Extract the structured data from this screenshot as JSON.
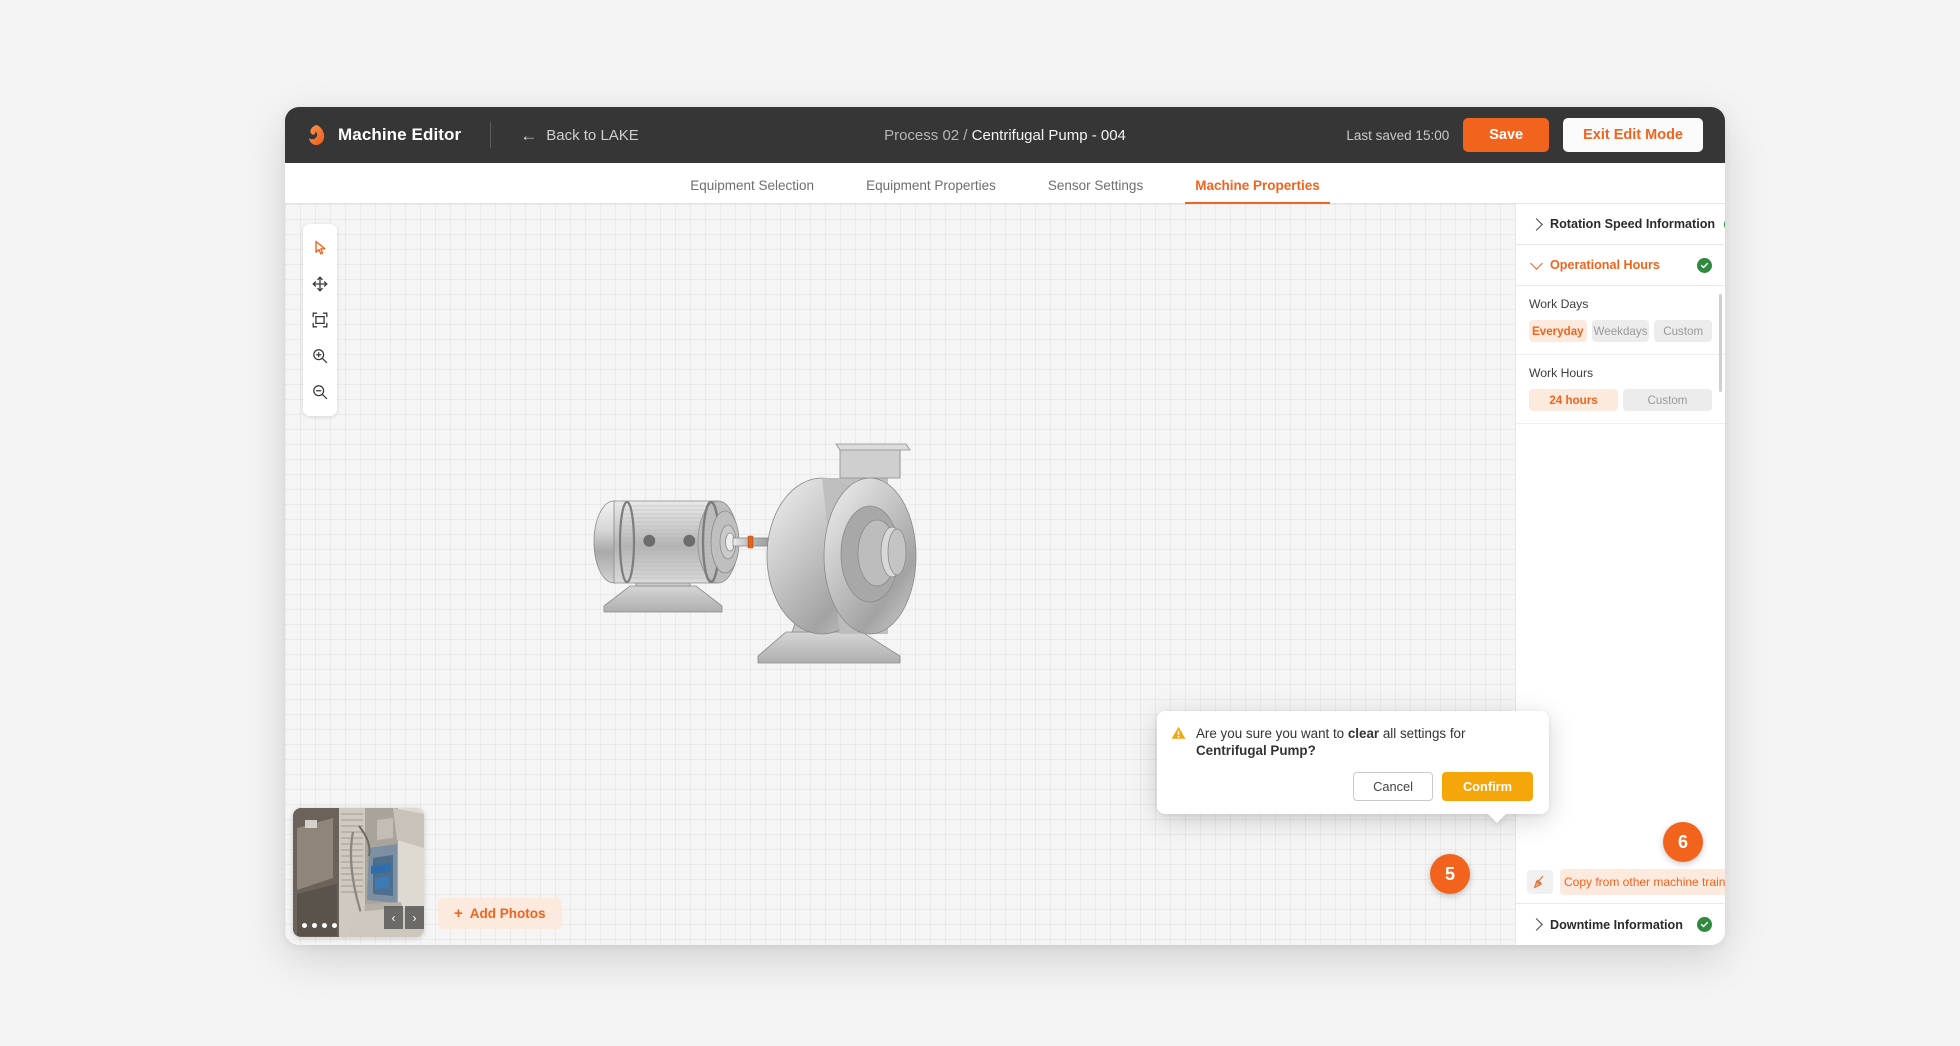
{
  "app": {
    "brand_name": "Machine Editor",
    "logo_icon": "leaf-swirl-logo",
    "back_label": "Back to LAKE",
    "back_icon": "arrow-left-icon"
  },
  "header": {
    "breadcrumb_parent": "Process 02 /",
    "breadcrumb_current": "Centrifugal Pump - 004",
    "last_saved": "Last saved 15:00",
    "save_label": "Save",
    "exit_label": "Exit Edit Mode"
  },
  "tabs": [
    {
      "label": "Equipment Selection",
      "active": false
    },
    {
      "label": "Equipment Properties",
      "active": false
    },
    {
      "label": "Sensor Settings",
      "active": false
    },
    {
      "label": "Machine Properties",
      "active": true
    }
  ],
  "toolbar": {
    "items": [
      {
        "icon": "cursor-select-icon",
        "active": true
      },
      {
        "icon": "move-pan-icon",
        "active": false
      },
      {
        "icon": "fit-to-frame-icon",
        "active": false
      },
      {
        "icon": "zoom-in-icon",
        "active": false
      },
      {
        "icon": "zoom-out-icon",
        "active": false
      }
    ]
  },
  "canvas": {
    "illustration": "motor-and-centrifugal-pump-3d-render"
  },
  "photos": {
    "thumbnail_alt": "industrial-pump-site-photo",
    "dot_count": 4,
    "prev_icon": "chevron-left-icon",
    "next_icon": "chevron-right-icon",
    "add_label": "Add Photos",
    "add_icon": "plus-icon"
  },
  "panel": {
    "sections": [
      {
        "title": "Rotation Speed Information",
        "open": false,
        "status": "complete"
      },
      {
        "title": "Operational Hours",
        "open": true,
        "status": "complete"
      },
      {
        "title": "Downtime Information",
        "open": false,
        "status": "complete"
      }
    ],
    "operational_hours": {
      "work_days": {
        "label": "Work Days",
        "options": [
          "Everyday",
          "Weekdays",
          "Custom"
        ],
        "selected": "Everyday"
      },
      "work_hours": {
        "label": "Work Hours",
        "options": [
          "24 hours",
          "Custom"
        ],
        "selected": "24 hours"
      }
    },
    "copy_row": {
      "clear_icon": "broom-clear-icon",
      "copy_label": "Copy from other machine train"
    },
    "status_icon": "check-circle-icon",
    "collapsed_icon": "chevron-right-icon",
    "expanded_icon": "chevron-down-icon"
  },
  "dialog": {
    "warning_icon": "warning-triangle-icon",
    "message_prefix": "Are you sure you want to ",
    "message_strong": "clear",
    "message_middle": " all settings for ",
    "message_target": "Centrifugal Pump?",
    "cancel_label": "Cancel",
    "confirm_label": "Confirm"
  },
  "step_badges": [
    {
      "number": "5"
    },
    {
      "number": "6"
    }
  ],
  "colors": {
    "accent": "#f2631d",
    "accent_soft": "#fdeade",
    "topbar": "#363636",
    "confirm": "#f5a60b",
    "status_green": "#2f8a3f",
    "canvas": "#f5f5f5"
  }
}
